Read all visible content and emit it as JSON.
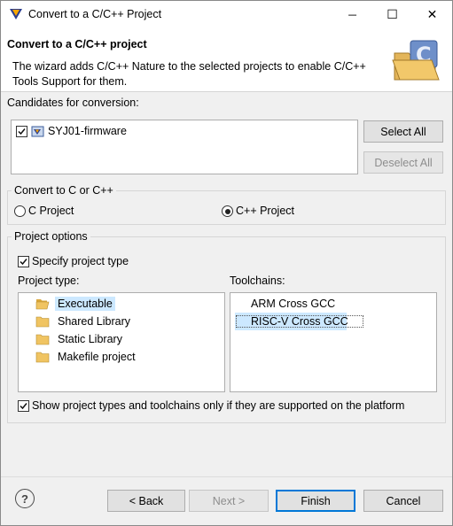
{
  "window": {
    "title": "Convert to a C/C++ Project",
    "controls": {
      "minimize": "─",
      "maximize": "☐",
      "close": "✕"
    }
  },
  "banner": {
    "heading": "Convert to a C/C++ project",
    "description": "The wizard adds C/C++ Nature to the selected projects to enable C/C++ Tools Support for them.",
    "icon": "c-wizard-folder-icon",
    "icon_letter": "C"
  },
  "candidates": {
    "label": "Candidates for conversion:",
    "items": [
      {
        "name": "SYJ01-firmware",
        "checked": true
      }
    ],
    "select_all": "Select All",
    "deselect_all": "Deselect All"
  },
  "convert": {
    "label": "Convert to C or C++",
    "options": [
      {
        "label": "C Project",
        "selected": false
      },
      {
        "label": "C++ Project",
        "selected": true
      }
    ]
  },
  "project_options": {
    "label": "Project options",
    "specify_type": {
      "label": "Specify project type",
      "checked": true
    },
    "project_type_label": "Project type:",
    "project_types": [
      "Executable",
      "Shared Library",
      "Static Library",
      "Makefile project"
    ],
    "selected_project_type": "Executable",
    "toolchains_label": "Toolchains:",
    "toolchains": [
      "ARM Cross GCC",
      "RISC-V Cross GCC"
    ],
    "selected_toolchain": "RISC-V Cross GCC",
    "show_supported": {
      "label": "Show project types and toolchains only if they are supported on the platform",
      "checked": true
    }
  },
  "footer": {
    "help": "?",
    "back": "< Back",
    "next": "Next >",
    "finish": "Finish",
    "cancel": "Cancel"
  },
  "colors": {
    "selection": "#cce8ff",
    "default_button_border": "#0078d7",
    "folder": "#e8b84a"
  }
}
